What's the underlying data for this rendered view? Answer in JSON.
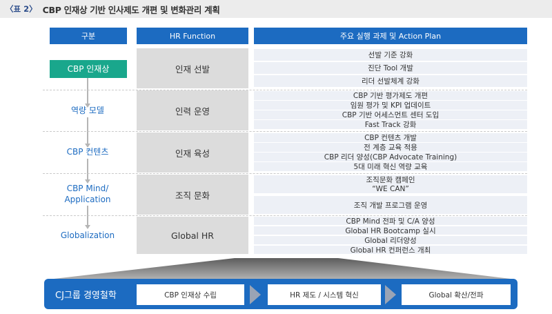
{
  "title": {
    "tag": "〈표 2〉",
    "text": "CBP 인재상 기반 인사제도 개편 및 변화관리 계획"
  },
  "headers": {
    "category": "구분",
    "function": "HR Function",
    "plan": "주요 실행 과제 및 Action Plan"
  },
  "rows": [
    {
      "category": "CBP 인재상",
      "function": "인재 선발",
      "plans": [
        "선발 기준 강화",
        "진단 Tool 개발",
        "리더 선발체계 강화"
      ]
    },
    {
      "category": "역량 모델",
      "function": "인력 운영",
      "plans": [
        "CBP 기반 평가제도 개편",
        "임원 평가 및 KPI 업데이트",
        "CBP 기반 어세스먼트 센터 도입",
        "Fast Track 강화"
      ]
    },
    {
      "category": "CBP 컨텐츠",
      "function": "인재 육성",
      "plans": [
        "CBP 컨텐츠 개발",
        "전 계층 교육 적용",
        "CBP 리더 양성(CBP Advocate Training)",
        "5대 미래 혁신 역량 교육"
      ]
    },
    {
      "category_lines": [
        "CBP Mind/",
        "Application"
      ],
      "function": "조직 문화",
      "plans": [
        "조직문화 캠페인",
        "“WE CAN”",
        "조직 개발 프로그램 운영"
      ]
    },
    {
      "category": "Globalization",
      "function": "Global HR",
      "plans": [
        "CBP Mind 전파 및 C/A 양성",
        "Global HR Bootcamp 실시",
        "Global 리더양성",
        "Global HR 컨퍼런스 개최"
      ]
    }
  ],
  "bottom": {
    "label": "CJ그룹 경영철학",
    "steps": [
      "CBP 인재상 수립",
      "HR 제도 / 시스템 혁신",
      "Global 확산/전파"
    ]
  },
  "colors": {
    "header": "#1c6bc1",
    "highlight": "#19a78c",
    "function_bg": "#dcdcdc",
    "plan_bg": "#edf0f6"
  }
}
